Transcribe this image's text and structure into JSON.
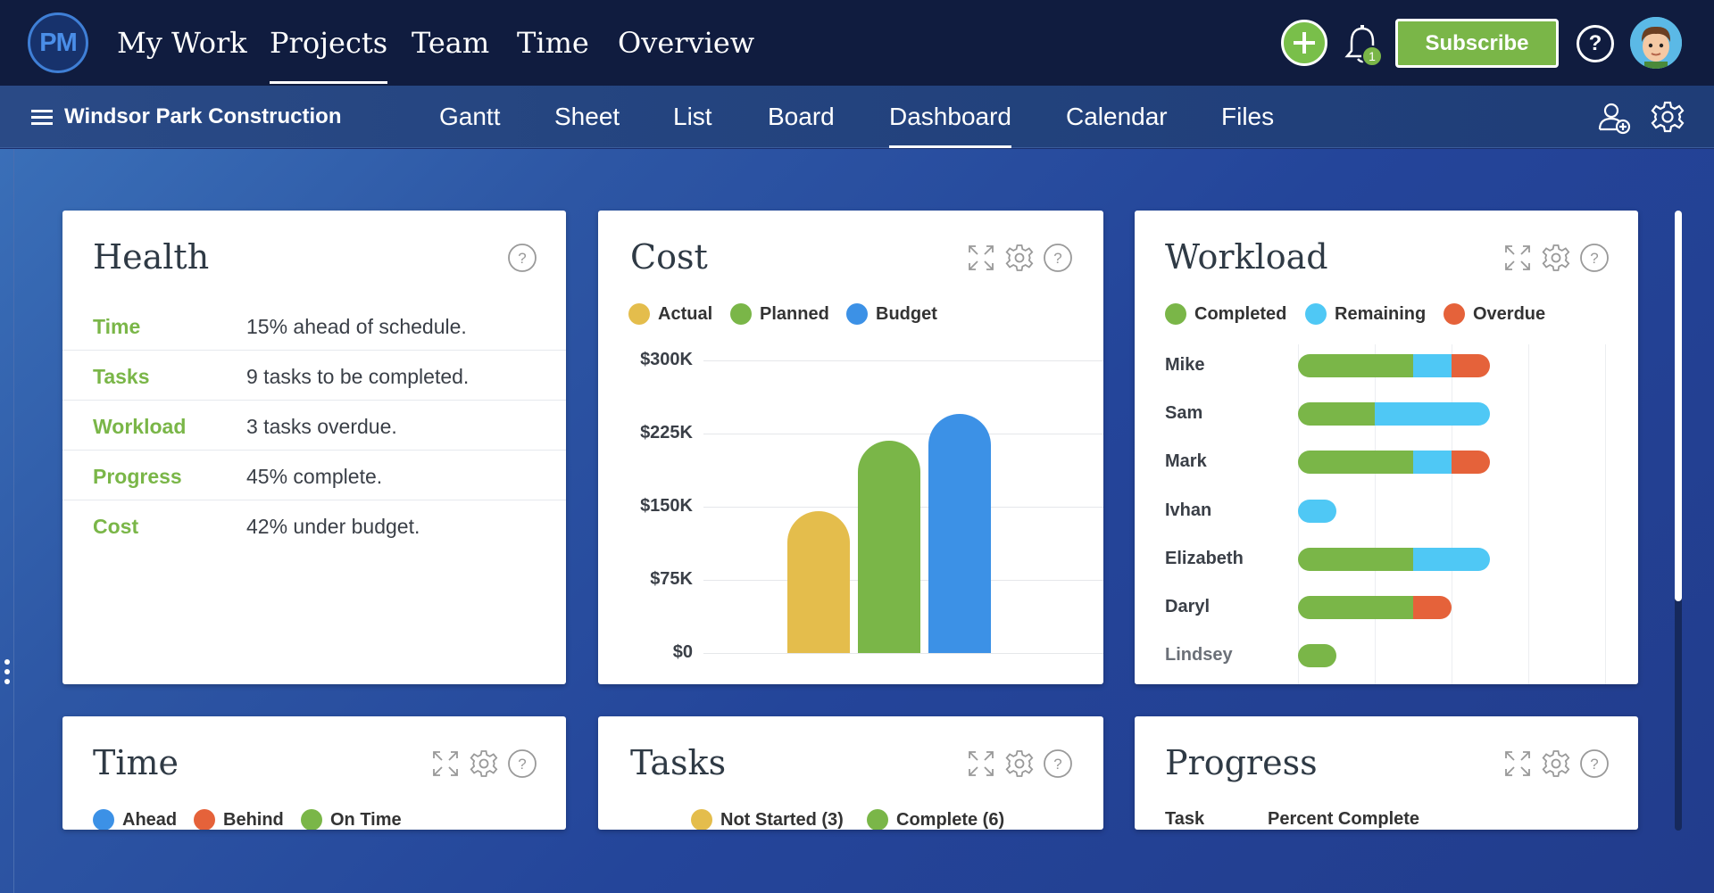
{
  "app": {
    "logo": "PM",
    "nav": [
      "My Work",
      "Projects",
      "Team",
      "Time",
      "Overview"
    ],
    "active_nav": "Projects",
    "notification_count": "1",
    "subscribe_label": "Subscribe",
    "help": "?"
  },
  "project": {
    "title": "Windsor Park Construction",
    "views": [
      "Gantt",
      "Sheet",
      "List",
      "Board",
      "Dashboard",
      "Calendar",
      "Files"
    ],
    "active_view": "Dashboard"
  },
  "colors": {
    "green": "#7ab648",
    "yellow": "#e4bd4c",
    "blue": "#3c91e6",
    "cyan": "#4fc8f5",
    "orange": "#e5623a"
  },
  "health": {
    "title": "Health",
    "rows": [
      {
        "label": "Time",
        "value": "15% ahead of schedule."
      },
      {
        "label": "Tasks",
        "value": "9 tasks to be completed."
      },
      {
        "label": "Workload",
        "value": "3 tasks overdue."
      },
      {
        "label": "Progress",
        "value": "45% complete."
      },
      {
        "label": "Cost",
        "value": "42% under budget."
      }
    ]
  },
  "cost": {
    "title": "Cost",
    "legend": [
      "Actual",
      "Planned",
      "Budget"
    ]
  },
  "workload": {
    "title": "Workload",
    "legend": [
      "Completed",
      "Remaining",
      "Overdue"
    ]
  },
  "chart_data": [
    {
      "type": "bar",
      "title": "Cost",
      "categories": [
        "Actual",
        "Planned",
        "Budget"
      ],
      "values": [
        145000,
        218000,
        245000
      ],
      "y_tick_labels": [
        "$300K",
        "$225K",
        "$150K",
        "$75K",
        "$0"
      ],
      "ylim": [
        0,
        300000
      ],
      "colors": [
        "#e4bd4c",
        "#7ab648",
        "#3c91e6"
      ],
      "legend": "top-left",
      "grid": true
    },
    {
      "type": "bar",
      "title": "Workload",
      "orientation": "horizontal",
      "stacked": true,
      "categories": [
        "Mike",
        "Sam",
        "Mark",
        "Ivhan",
        "Elizabeth",
        "Daryl",
        "Lindsey"
      ],
      "series": [
        {
          "name": "Completed",
          "values": [
            3,
            2,
            3,
            0,
            3,
            3,
            1
          ],
          "color": "#7ab648"
        },
        {
          "name": "Remaining",
          "values": [
            1,
            3,
            1,
            1,
            2,
            0,
            0
          ],
          "color": "#4fc8f5"
        },
        {
          "name": "Overdue",
          "values": [
            1,
            0,
            1,
            0,
            0,
            1,
            0
          ],
          "color": "#e5623a"
        }
      ],
      "legend": "top-left",
      "grid": true
    }
  ],
  "time_card": {
    "title": "Time",
    "legend": [
      "Ahead",
      "Behind",
      "On Time"
    ]
  },
  "tasks_card": {
    "title": "Tasks",
    "legend": [
      "Not Started (3)",
      "Complete (6)"
    ]
  },
  "progress_card": {
    "title": "Progress",
    "columns": [
      "Task",
      "Percent Complete"
    ]
  }
}
